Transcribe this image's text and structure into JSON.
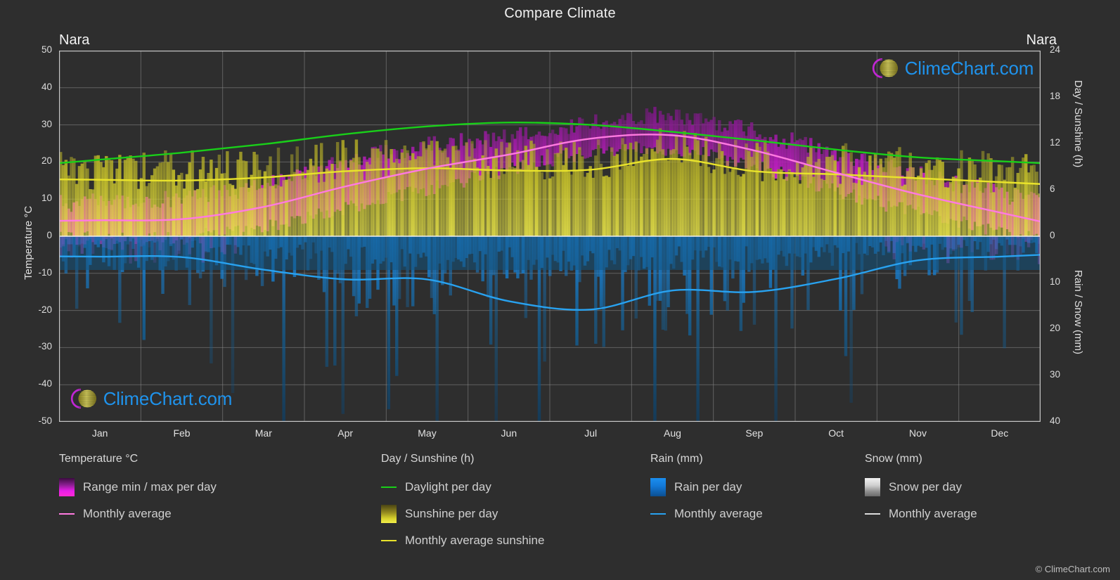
{
  "header": {
    "title": "Compare Climate",
    "location_left": "Nara",
    "location_right": "Nara"
  },
  "branding": {
    "logo_text": "ClimeChart.com",
    "copyright": "© ClimeChart.com",
    "logo_word_color": "#1f93ec",
    "logo_arc_color": "#c026d3",
    "logo_sphere_color": "#e0d23a"
  },
  "axes": {
    "left_label": "Temperature °C",
    "right_top_label": "Day / Sunshine (h)",
    "right_bottom_label": "Rain / Snow (mm)",
    "left_ticks": [
      "50",
      "40",
      "30",
      "20",
      "10",
      "0",
      "-10",
      "-20",
      "-30",
      "-40",
      "-50"
    ],
    "right_top_ticks": [
      "24",
      "18",
      "12",
      "6",
      "0"
    ],
    "right_bottom_ticks": [
      "0",
      "10",
      "20",
      "30",
      "40"
    ],
    "months": [
      "Jan",
      "Feb",
      "Mar",
      "Apr",
      "May",
      "Jun",
      "Jul",
      "Aug",
      "Sep",
      "Oct",
      "Nov",
      "Dec"
    ]
  },
  "legend": {
    "groups": [
      {
        "heading": "Temperature °C",
        "items": [
          {
            "label": "Range min / max per day",
            "key": "gradient",
            "swatch": "swatch-temp",
            "color": "#e81ee8"
          },
          {
            "label": "Monthly average",
            "key": "line",
            "swatch": "",
            "color": "#ff7ae0"
          }
        ]
      },
      {
        "heading": "Day / Sunshine (h)",
        "items": [
          {
            "label": "Daylight per day",
            "key": "line",
            "swatch": "",
            "color": "#19cf19"
          },
          {
            "label": "Sunshine per day",
            "key": "gradient",
            "swatch": "swatch-sun",
            "color": "#d6d02c"
          },
          {
            "label": "Monthly average sunshine",
            "key": "line",
            "swatch": "",
            "color": "#e9e32b"
          }
        ]
      },
      {
        "heading": "Rain (mm)",
        "items": [
          {
            "label": "Rain per day",
            "key": "gradient",
            "swatch": "swatch-rain",
            "color": "#1b8ff0"
          },
          {
            "label": "Monthly average",
            "key": "line",
            "swatch": "",
            "color": "#28a2f0"
          }
        ]
      },
      {
        "heading": "Snow (mm)",
        "items": [
          {
            "label": "Snow per day",
            "key": "gradient",
            "swatch": "swatch-snow",
            "color": "#dcdcdc"
          },
          {
            "label": "Monthly average",
            "key": "line",
            "swatch": "",
            "color": "#dcdcdc"
          }
        ]
      }
    ]
  },
  "chart_data": {
    "type": "line",
    "title": "Compare Climate",
    "subtitle": "Nara",
    "xlabel": "",
    "ylabel": "Temperature °C",
    "ylabel_right_top": "Day / Sunshine (h)",
    "ylabel_right_bottom": "Rain / Snow (mm)",
    "grid": true,
    "legend_position": "bottom",
    "categories": [
      "Jan",
      "Feb",
      "Mar",
      "Apr",
      "May",
      "Jun",
      "Jul",
      "Aug",
      "Sep",
      "Oct",
      "Nov",
      "Dec"
    ],
    "axis_temperature": {
      "range": [
        -50,
        50
      ],
      "unit": "°C",
      "ticks": [
        50,
        40,
        30,
        20,
        10,
        0,
        -10,
        -20,
        -30,
        -40,
        -50
      ]
    },
    "axis_daylight": {
      "range": [
        0,
        24
      ],
      "unit": "h",
      "ticks": [
        24,
        18,
        12,
        6,
        0
      ]
    },
    "axis_precip": {
      "range": [
        0,
        40
      ],
      "unit": "mm",
      "ticks": [
        0,
        10,
        20,
        30,
        40
      ]
    },
    "series": [
      {
        "name": "Monthly average",
        "group": "Temperature °C",
        "axis": "temperature",
        "unit": "°C",
        "color": "#ff7ae0",
        "values": [
          4.3,
          4.6,
          7.9,
          13.4,
          18.2,
          22.0,
          26.3,
          27.2,
          23.1,
          17.1,
          11.3,
          6.4
        ]
      },
      {
        "name": "Range min per day",
        "group": "Temperature °C",
        "axis": "temperature",
        "unit": "°C",
        "color": "#8c1f93",
        "values": [
          -0.5,
          -0.2,
          2.3,
          7.4,
          12.5,
          17.8,
          22.5,
          23.3,
          19.2,
          12.2,
          6.2,
          1.4
        ]
      },
      {
        "name": "Range max per day",
        "group": "Temperature °C",
        "axis": "temperature",
        "unit": "°C",
        "color": "#e81ee8",
        "values": [
          9.2,
          10.1,
          13.9,
          20.1,
          24.4,
          27.1,
          30.8,
          32.4,
          28.2,
          22.4,
          16.6,
          11.5
        ]
      },
      {
        "name": "Daylight per day",
        "group": "Day / Sunshine (h)",
        "axis": "daylight",
        "unit": "h",
        "color": "#19cf19",
        "values": [
          9.9,
          10.8,
          11.9,
          13.2,
          14.2,
          14.7,
          14.4,
          13.5,
          12.4,
          11.2,
          10.2,
          9.7
        ]
      },
      {
        "name": "Monthly average sunshine",
        "group": "Day / Sunshine (h)",
        "axis": "daylight",
        "unit": "h",
        "color": "#e9e32b",
        "values": [
          7.3,
          7.2,
          7.6,
          8.4,
          8.8,
          8.5,
          8.6,
          10.0,
          8.4,
          8.0,
          7.5,
          7.0
        ]
      },
      {
        "name": "Monthly average rain",
        "group": "Rain (mm)",
        "axis": "precip",
        "unit": "mm",
        "color": "#28a2f0",
        "values": [
          4.4,
          4.5,
          7.2,
          9.3,
          9.3,
          14.0,
          15.8,
          11.7,
          12.0,
          9.2,
          5.2,
          4.4
        ]
      },
      {
        "name": "Monthly average snow",
        "group": "Snow (mm)",
        "axis": "precip",
        "unit": "mm",
        "color": "#dcdcdc",
        "values": [
          0,
          0,
          0,
          0,
          0,
          0,
          0,
          0,
          0,
          0,
          0,
          0
        ]
      }
    ]
  }
}
